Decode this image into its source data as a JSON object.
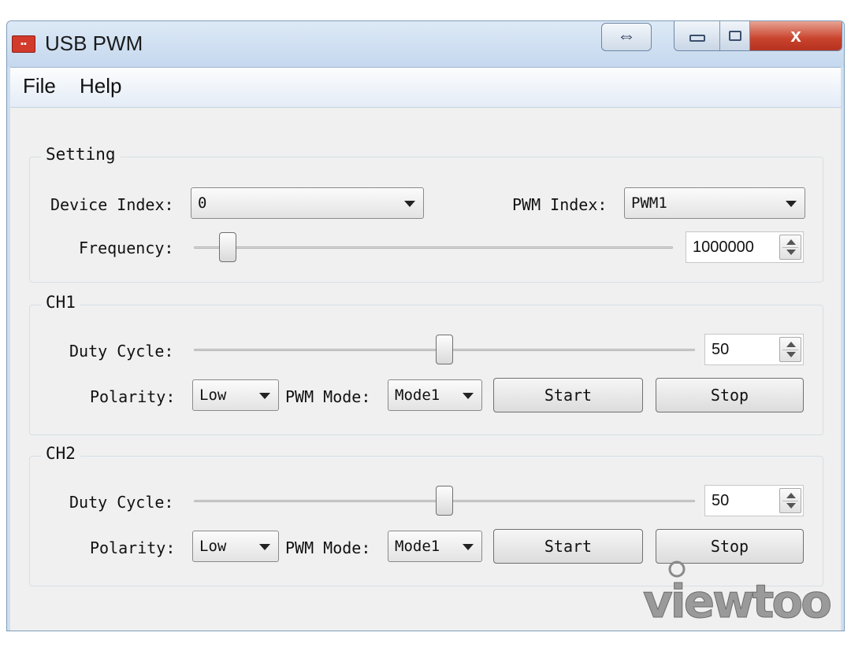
{
  "window": {
    "title": "USB PWM",
    "snap_icon": "⇔",
    "close_icon": "x"
  },
  "menu": {
    "file": "File",
    "help": "Help"
  },
  "setting": {
    "group_title": "Setting",
    "device_index_label": "Device Index:",
    "device_index_value": "0",
    "pwm_index_label": "PWM Index:",
    "pwm_index_value": "PWM1",
    "frequency_label": "Frequency:",
    "frequency_value": "1000000",
    "frequency_slider_fraction": 0.07
  },
  "ch1": {
    "group_title": "CH1",
    "duty_cycle_label": "Duty Cycle:",
    "duty_cycle_value": "50",
    "duty_slider_fraction": 0.5,
    "polarity_label": "Polarity:",
    "polarity_value": "Low",
    "pwm_mode_label": "PWM Mode:",
    "pwm_mode_value": "Mode1",
    "start_label": "Start",
    "stop_label": "Stop"
  },
  "ch2": {
    "group_title": "CH2",
    "duty_cycle_label": "Duty Cycle:",
    "duty_cycle_value": "50",
    "duty_slider_fraction": 0.5,
    "polarity_label": "Polarity:",
    "polarity_value": "Low",
    "pwm_mode_label": "PWM Mode:",
    "pwm_mode_value": "Mode1",
    "start_label": "Start",
    "stop_label": "Stop"
  },
  "watermark": {
    "text": "viewtool"
  },
  "colors": {
    "titlebar": "#c5d8ee",
    "close_button": "#c9432c",
    "client_background": "#f0f0f0"
  }
}
